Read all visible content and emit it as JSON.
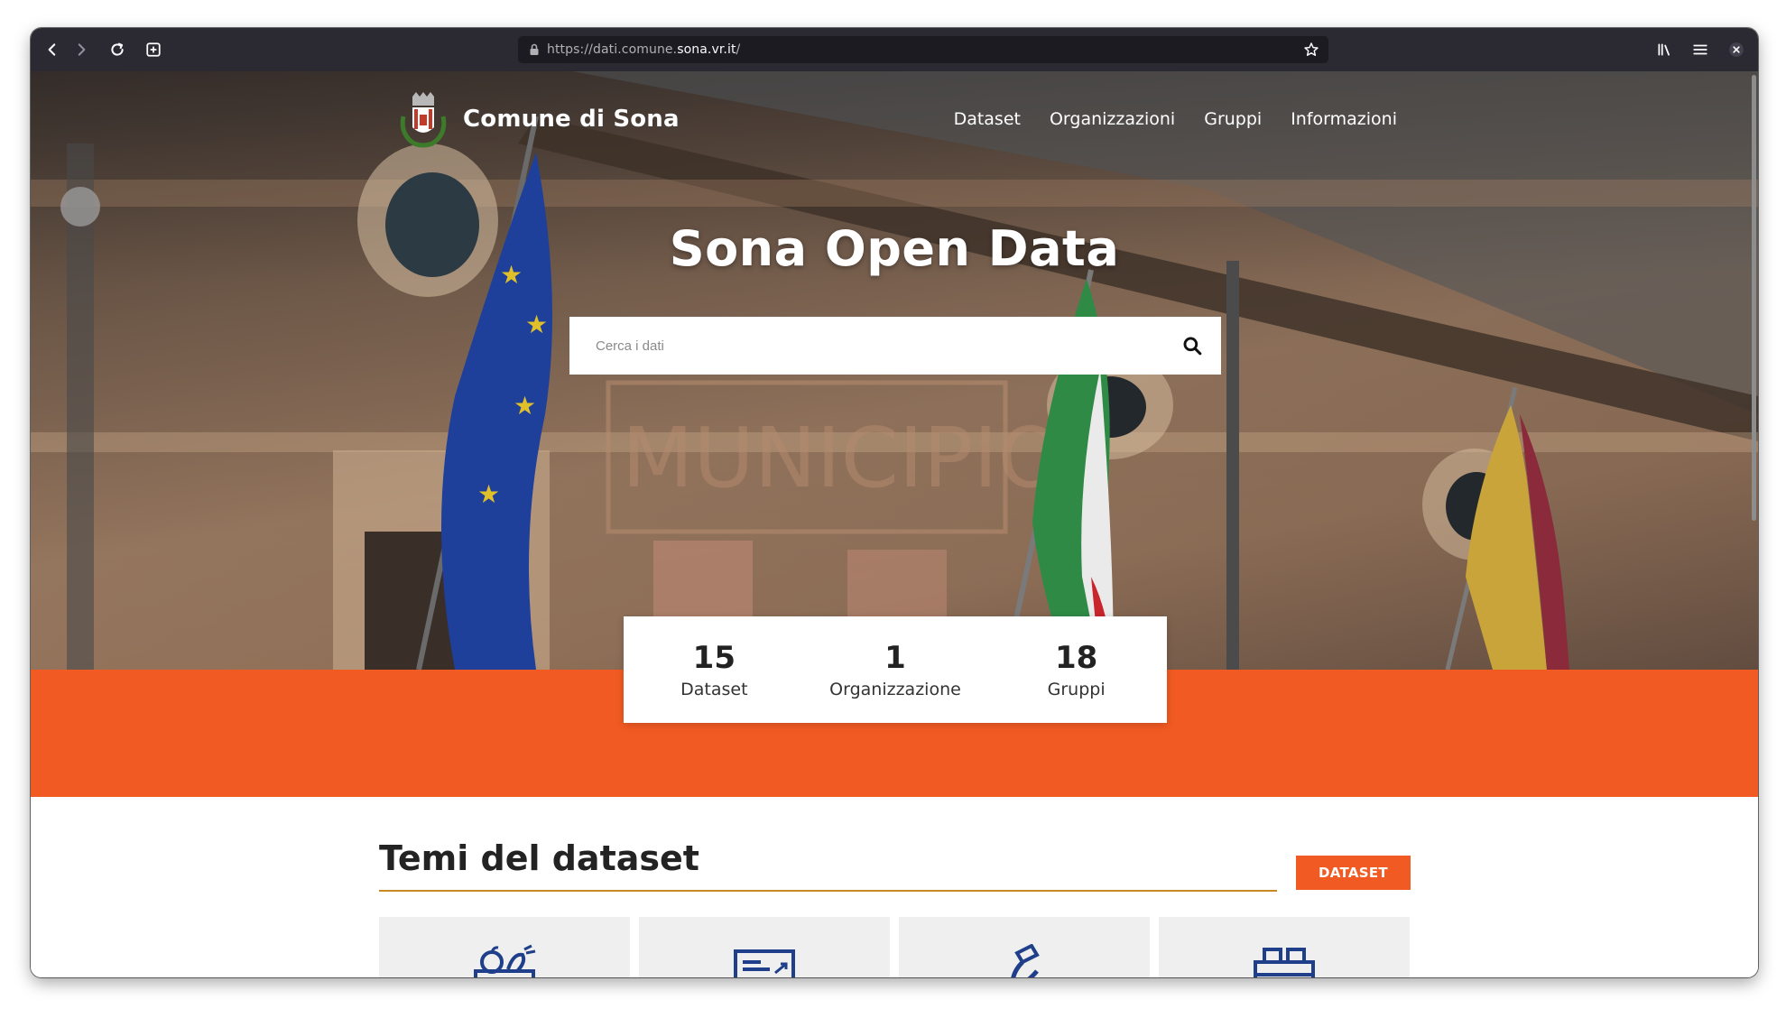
{
  "browser": {
    "url_prefix": "https://dati.comune.",
    "url_domain": "sona.vr.it",
    "url_suffix": "/"
  },
  "header": {
    "brand_name": "Comune di Sona",
    "nav": [
      "Dataset",
      "Organizzazioni",
      "Gruppi",
      "Informazioni"
    ]
  },
  "hero": {
    "title": "Sona Open Data",
    "search_placeholder": "Cerca i dati"
  },
  "stats": [
    {
      "value": "15",
      "label": "Dataset"
    },
    {
      "value": "1",
      "label": "Organizzazione"
    },
    {
      "value": "18",
      "label": "Gruppi"
    }
  ],
  "themes": {
    "title": "Temi del dataset",
    "button_label": "DATASET",
    "tiles": [
      {
        "icon": "food-agriculture-icon"
      },
      {
        "icon": "economy-finance-icon"
      },
      {
        "icon": "science-technology-icon"
      },
      {
        "icon": "transport-icon"
      }
    ]
  },
  "colors": {
    "accent": "#f15a22",
    "rule": "#c58a22",
    "icon_blue": "#1f3f8a"
  }
}
